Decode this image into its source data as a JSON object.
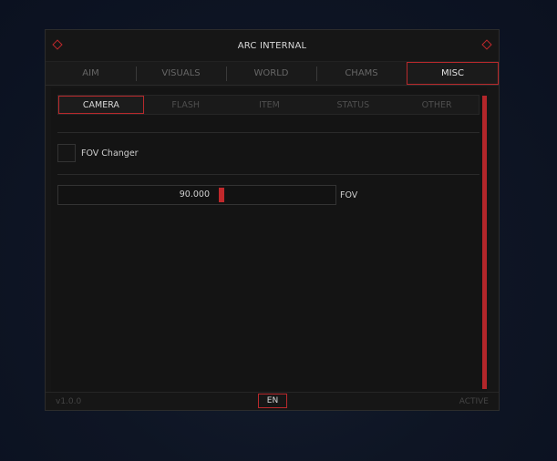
{
  "window": {
    "title": "ARC INTERNAL"
  },
  "tabs": [
    {
      "label": "AIM"
    },
    {
      "label": "VISUALS"
    },
    {
      "label": "WORLD"
    },
    {
      "label": "CHAMS"
    },
    {
      "label": "MISC",
      "active": true
    }
  ],
  "subtabs": [
    {
      "label": "CAMERA",
      "active": true
    },
    {
      "label": "FLASH"
    },
    {
      "label": "ITEM"
    },
    {
      "label": "STATUS"
    },
    {
      "label": "OTHER"
    }
  ],
  "camera": {
    "fov_changer": {
      "label": "FOV Changer",
      "checked": false
    },
    "fov_slider": {
      "label": "FOV",
      "value": "90.000",
      "fraction": 0.59
    }
  },
  "footer": {
    "version": "v1.0.0",
    "language": "EN",
    "status": "ACTIVE"
  },
  "colors": {
    "accent": "#c0282b",
    "background": "#161616",
    "text": "#d8d8d8",
    "muted": "#666666"
  }
}
